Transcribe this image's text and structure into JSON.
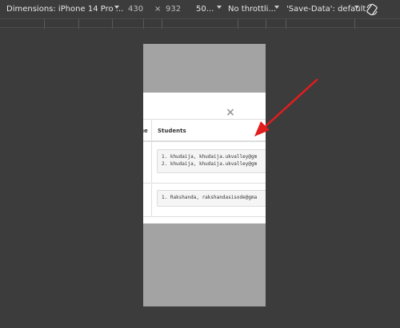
{
  "toolbar": {
    "dimensions_label": "Dimensions: iPhone 14 Pro ...",
    "width": "430",
    "times": "×",
    "height": "932",
    "zoom": "50...",
    "throttle": "No throttli...",
    "save_data": "'Save-Data': default",
    "rotate_icon": "rotate-icon"
  },
  "modal": {
    "close": "×",
    "headers": {
      "age_partial": "ge",
      "students": "Students"
    },
    "rows": [
      {
        "lines": [
          "1. khudaija, khudaija.ukvalley@gm",
          "2. khudaija, khudaija.ukvalley@gm"
        ]
      },
      {
        "lines": [
          "1. Rakshanda, rakshandasisode@gma"
        ]
      }
    ]
  },
  "colors": {
    "annotation_arrow": "#e11d1d",
    "devtools_bg": "#3c3c3c",
    "device_backdrop": "#a3a3a3"
  }
}
